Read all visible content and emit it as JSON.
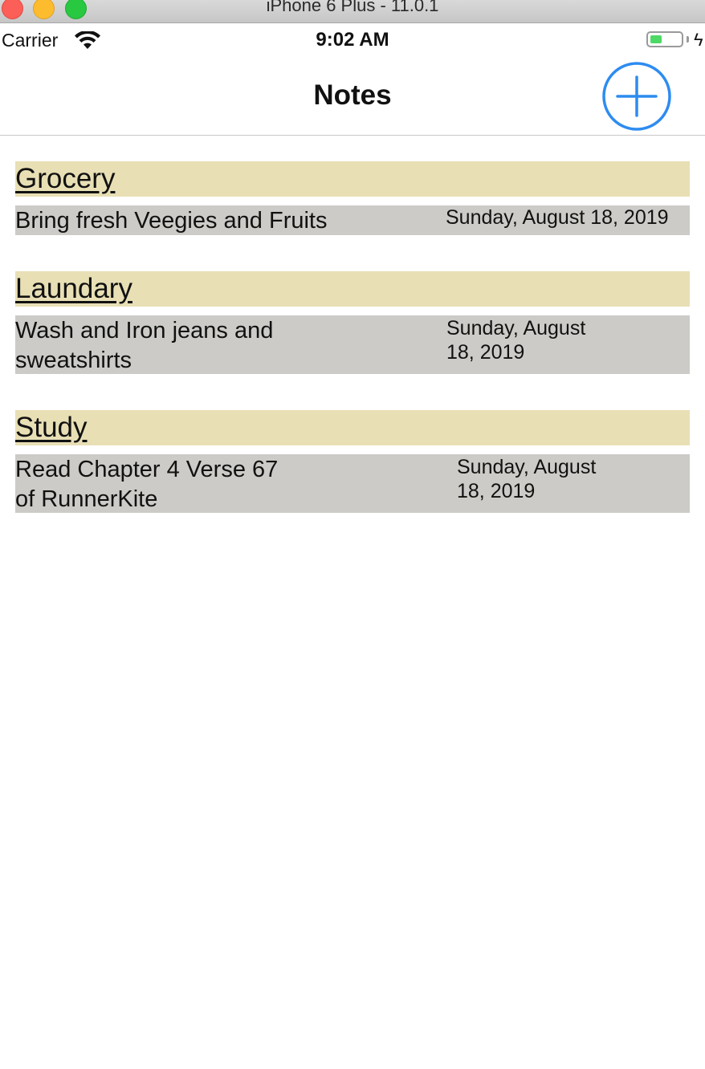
{
  "window": {
    "title": "iPhone 6 Plus - 11.0.1"
  },
  "statusbar": {
    "carrier": "Carrier",
    "time": "9:02 AM",
    "battery_level": 0.4
  },
  "navbar": {
    "title": "Notes",
    "add_icon": "plus-circle-icon",
    "accent_color": "#2d8cf0"
  },
  "colors": {
    "title_bar": "#e8dfb5",
    "body_bar": "#cccbc7"
  },
  "notes": [
    {
      "title": "Grocery",
      "body_line1": "Bring fresh Veegies and Fruits",
      "body_line2": "",
      "date_line1": "Sunday, August 18, 2019",
      "date_line2": ""
    },
    {
      "title": "Laundary",
      "body_line1": "Wash and Iron jeans and",
      "body_line2": "sweatshirts",
      "date_line1": "Sunday, August",
      "date_line2": "18, 2019"
    },
    {
      "title": "Study",
      "body_line1": "Read Chapter 4 Verse 67",
      "body_line2": "of RunnerKite",
      "date_line1": "Sunday, August",
      "date_line2": "18, 2019"
    }
  ]
}
